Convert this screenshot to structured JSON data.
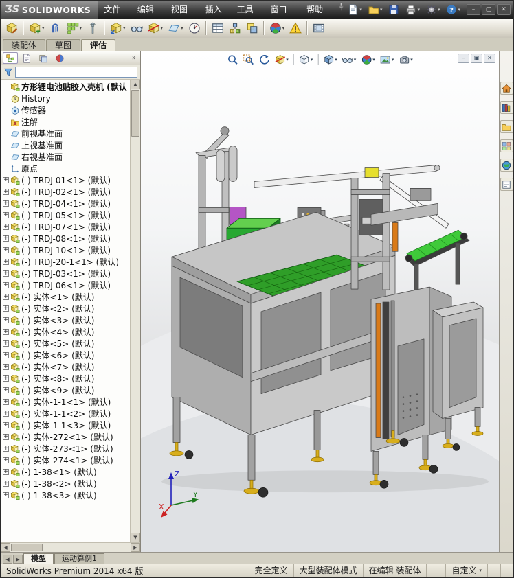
{
  "app": {
    "logo_mark": "ƷS",
    "logo_text": "SOLIDWORKS"
  },
  "menubar": {
    "items": [
      "文件(F)",
      "编辑(E)",
      "视图(V)",
      "插入(I)",
      "工具(T)",
      "窗口(W)",
      "帮助(H)"
    ]
  },
  "quickbar": {
    "buttons": [
      {
        "name": "new-document",
        "glyph": "doc",
        "caret": true
      },
      {
        "name": "open",
        "glyph": "folder",
        "caret": true
      },
      {
        "name": "save",
        "glyph": "save",
        "caret": false
      },
      {
        "name": "print",
        "glyph": "printer",
        "caret": true
      },
      {
        "name": "options",
        "glyph": "gear",
        "caret": true
      },
      {
        "name": "help",
        "glyph": "question",
        "caret": true
      }
    ]
  },
  "window_controls": [
    "minimize",
    "maximize",
    "close"
  ],
  "toolbar": {
    "buttons": [
      {
        "name": "edit-component",
        "glyph": "cubeEdit"
      },
      {
        "sep": true
      },
      {
        "name": "insert-components",
        "glyph": "cubePlus",
        "caret": true
      },
      {
        "name": "mate",
        "glyph": "mate"
      },
      {
        "name": "linear-component-pattern",
        "glyph": "grid",
        "caret": true
      },
      {
        "name": "smart-fasteners",
        "glyph": "bolt"
      },
      {
        "sep": true
      },
      {
        "name": "move-component",
        "glyph": "cubeArrows",
        "caret": true
      },
      {
        "name": "show-hidden-components",
        "glyph": "glasses"
      },
      {
        "name": "assembly-features",
        "glyph": "cubeCut",
        "caret": true
      },
      {
        "name": "reference-geometry",
        "glyph": "planeG",
        "caret": true
      },
      {
        "name": "new-motion-study",
        "glyph": "gauge"
      },
      {
        "sep": true
      },
      {
        "name": "bill-of-materials",
        "glyph": "table"
      },
      {
        "name": "exploded-view",
        "glyph": "explode"
      },
      {
        "name": "interference-detection",
        "glyph": "cubes2"
      },
      {
        "sep": true
      },
      {
        "name": "appearances",
        "glyph": "sphere",
        "caret": true
      },
      {
        "name": "assemblyxpert",
        "glyph": "warning"
      },
      {
        "sep": true
      },
      {
        "name": "motion-manager",
        "glyph": "film"
      }
    ]
  },
  "command_tabs": {
    "tabs": [
      {
        "label": "装配体",
        "active": false
      },
      {
        "label": "草图",
        "active": false
      },
      {
        "label": "评估",
        "active": true
      }
    ]
  },
  "feature_panel": {
    "manager_tabs": [
      {
        "name": "featuremanager",
        "glyph": "tree",
        "active": true
      },
      {
        "name": "propertymanager",
        "glyph": "page",
        "active": false
      },
      {
        "name": "configurationmanager",
        "glyph": "stack",
        "active": false
      },
      {
        "name": "displaymanager",
        "glyph": "ballRB",
        "active": false
      }
    ],
    "overflow_label": "»",
    "filter": {
      "value": ""
    },
    "root": {
      "label": "方形锂电池贴胶入壳机 (默认",
      "icon": "assembly"
    },
    "items": [
      {
        "icon": "history",
        "label": "History"
      },
      {
        "icon": "sensors",
        "label": "传感器"
      },
      {
        "icon": "annotations",
        "label": "注解"
      },
      {
        "icon": "plane",
        "label": "前视基准面"
      },
      {
        "icon": "plane",
        "label": "上视基准面"
      },
      {
        "icon": "plane",
        "label": "右视基准面"
      },
      {
        "icon": "origin",
        "label": "原点"
      },
      {
        "icon": "asm",
        "label": "(-) TRDJ-01<1> (默认)",
        "expandable": true
      },
      {
        "icon": "asm",
        "label": "(-) TRDJ-02<1> (默认)",
        "expandable": true
      },
      {
        "icon": "asm",
        "label": "(-) TRDJ-04<1> (默认)",
        "expandable": true
      },
      {
        "icon": "asm",
        "label": "(-) TRDJ-05<1> (默认)",
        "expandable": true
      },
      {
        "icon": "asm",
        "label": "(-) TRDJ-07<1> (默认)",
        "expandable": true
      },
      {
        "icon": "asm",
        "label": "(-) TRDJ-08<1> (默认)",
        "expandable": true
      },
      {
        "icon": "asm",
        "label": "(-) TRDJ-10<1> (默认)",
        "expandable": true
      },
      {
        "icon": "asm",
        "label": "(-) TRDJ-20-1<1> (默认)",
        "expandable": true
      },
      {
        "icon": "asm",
        "label": "(-) TRDJ-03<1> (默认)",
        "expandable": true
      },
      {
        "icon": "asm",
        "label": "(-) TRDJ-06<1> (默认)",
        "expandable": true
      },
      {
        "icon": "asm",
        "label": "(-) 实体<1> (默认)",
        "expandable": true
      },
      {
        "icon": "asm",
        "label": "(-) 实体<2> (默认)",
        "expandable": true
      },
      {
        "icon": "asm",
        "label": "(-) 实体<3> (默认)",
        "expandable": true
      },
      {
        "icon": "asm",
        "label": "(-) 实体<4> (默认)",
        "expandable": true
      },
      {
        "icon": "asm",
        "label": "(-) 实体<5> (默认)",
        "expandable": true
      },
      {
        "icon": "asm",
        "label": "(-) 实体<6> (默认)",
        "expandable": true
      },
      {
        "icon": "asm",
        "label": "(-) 实体<7> (默认)",
        "expandable": true
      },
      {
        "icon": "asm",
        "label": "(-) 实体<8> (默认)",
        "expandable": true
      },
      {
        "icon": "asm",
        "label": "(-) 实体<9> (默认)",
        "expandable": true
      },
      {
        "icon": "asm",
        "label": "(-) 实体-1-1<1> (默认)",
        "expandable": true
      },
      {
        "icon": "asm",
        "label": "(-) 实体-1-1<2> (默认)",
        "expandable": true
      },
      {
        "icon": "asm",
        "label": "(-) 实体-1-1<3> (默认)",
        "expandable": true
      },
      {
        "icon": "asm",
        "label": "(-) 实体-272<1> (默认)",
        "expandable": true
      },
      {
        "icon": "asm",
        "label": "(-) 实体-273<1> (默认)",
        "expandable": true
      },
      {
        "icon": "asm",
        "label": "(-) 实体-274<1> (默认)",
        "expandable": true
      },
      {
        "icon": "asm",
        "label": "(-) 1-38<1> (默认)",
        "expandable": true
      },
      {
        "icon": "asm",
        "label": "(-) 1-38<2> (默认)",
        "expandable": true
      },
      {
        "icon": "asm",
        "label": "(-) 1-38<3> (默认)",
        "expandable": true
      }
    ]
  },
  "headsup": {
    "buttons": [
      {
        "name": "zoom-to-fit",
        "glyph": "mag"
      },
      {
        "name": "zoom-to-area",
        "glyph": "magArea"
      },
      {
        "name": "previous-view",
        "glyph": "viewPrev"
      },
      {
        "name": "section-view",
        "glyph": "cubeCut",
        "caret": true
      },
      {
        "sep": true
      },
      {
        "name": "view-orientation",
        "glyph": "cubeOutline",
        "caret": true
      },
      {
        "sep": true
      },
      {
        "name": "display-style",
        "glyph": "cubeShaded",
        "caret": true
      },
      {
        "name": "hide-show-items",
        "glyph": "glasses",
        "caret": true
      },
      {
        "name": "edit-appearance",
        "glyph": "sphere",
        "caret": true
      },
      {
        "name": "apply-scene",
        "glyph": "photo",
        "caret": true
      },
      {
        "name": "view-settings",
        "glyph": "camera",
        "caret": true
      }
    ]
  },
  "doc_controls": [
    "minimize-document",
    "restore-document",
    "close-document"
  ],
  "task_pane": {
    "buttons": [
      {
        "name": "solidworks-resources",
        "glyph": "house"
      },
      {
        "name": "design-library",
        "glyph": "books"
      },
      {
        "name": "file-explorer",
        "glyph": "folder"
      },
      {
        "name": "view-palette",
        "glyph": "grid4"
      },
      {
        "name": "appearances-scenes",
        "glyph": "globe"
      },
      {
        "name": "custom-properties",
        "glyph": "list"
      }
    ]
  },
  "viewport": {
    "triad": {
      "x": "X",
      "y": "Y",
      "z": "Z"
    }
  },
  "bottom_tabs": {
    "tabs": [
      {
        "label": "模型",
        "active": true
      },
      {
        "label": "运动算例1",
        "active": false
      }
    ]
  },
  "status_bar": {
    "product": "SolidWorks Premium 2014 x64 版",
    "define_state": "完全定义",
    "assembly_mode": "大型装配体模式",
    "edit_state": "在编辑 装配体",
    "custom": "自定义",
    "icons": [
      "status-help",
      "quick-tips"
    ]
  },
  "model": {
    "title": "方形锂电池贴胶入壳机",
    "colors": {
      "frame": "#b8b8b8",
      "belt": "#3fca3a",
      "tray": "#2f9e28",
      "feet": "#d8ae1c",
      "accent_orange": "#d97a18"
    }
  }
}
